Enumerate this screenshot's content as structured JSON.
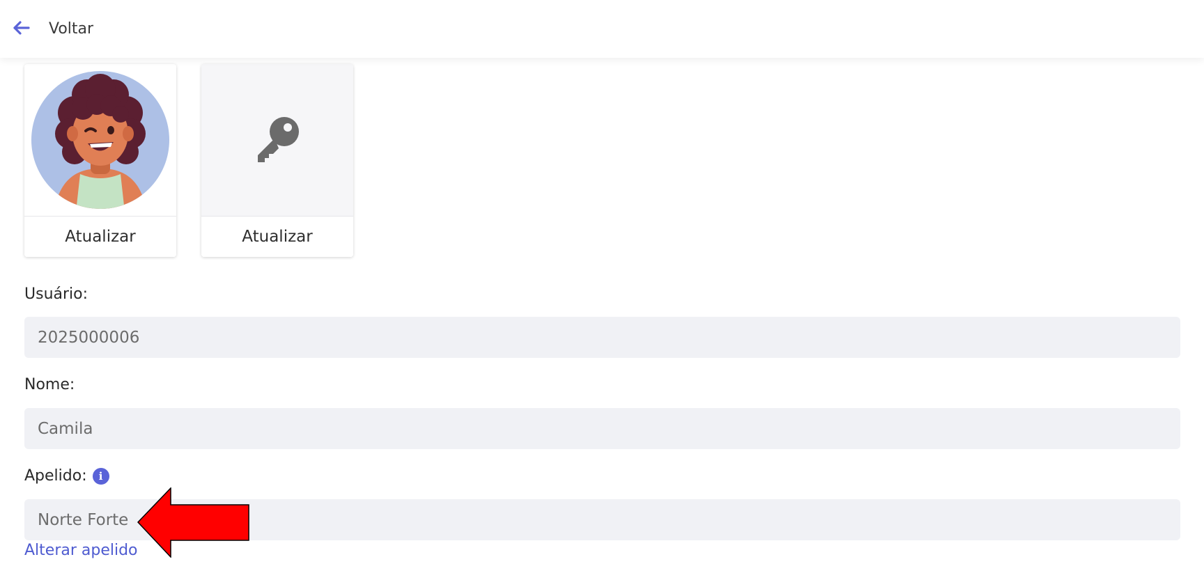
{
  "header": {
    "back_label": "Voltar"
  },
  "cards": [
    {
      "kind": "avatar",
      "button_label": "Atualizar"
    },
    {
      "kind": "password",
      "button_label": "Atualizar"
    }
  ],
  "fields": {
    "usuario": {
      "label": "Usuário:",
      "value": "2025000006"
    },
    "nome": {
      "label": "Nome:",
      "value": "Camila"
    },
    "apelido": {
      "label": "Apelido:",
      "value": "Norte Forte"
    }
  },
  "links": {
    "change_nickname": "Alterar apelido"
  },
  "icons": {
    "back": "arrow-left-icon",
    "key": "key-icon",
    "info": "info-icon",
    "annotation": "red-arrow-annotation"
  },
  "colors": {
    "accent": "#5a63d8",
    "link": "#4e5bd0",
    "input_bg": "#f0f1f5",
    "annotation": "#ff0000"
  }
}
